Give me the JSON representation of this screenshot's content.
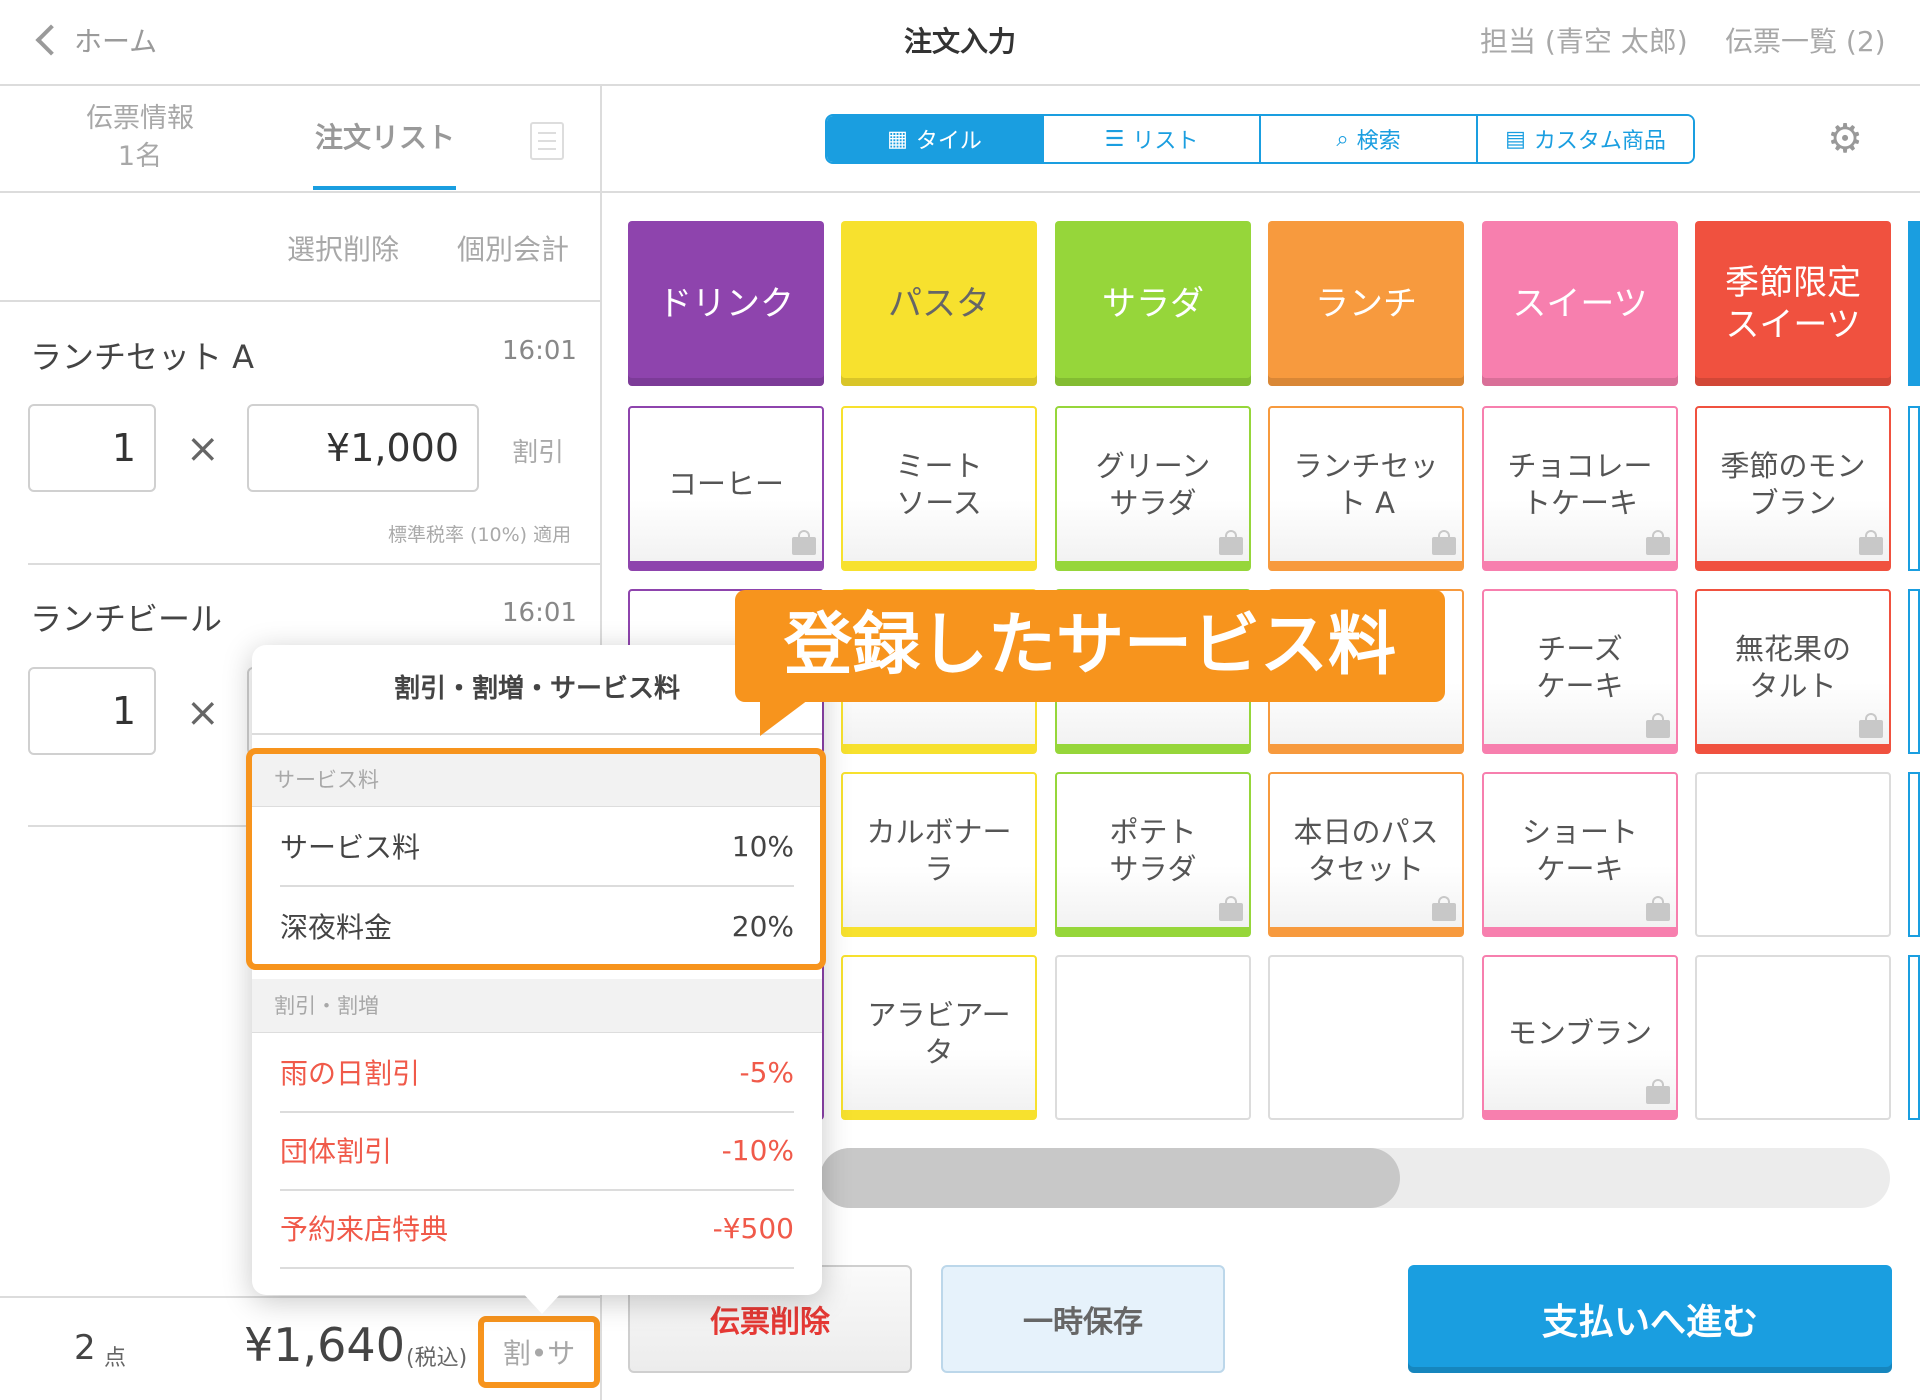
{
  "header": {
    "back_label": "ホーム",
    "title": "注文入力",
    "staff": "担当 (青空 太郎)",
    "slips": "伝票一覧 (2)"
  },
  "left_tabs": {
    "info_label": "伝票情報",
    "info_count": "1名",
    "order_label": "注文リスト"
  },
  "actions": {
    "select_delete": "選択削除",
    "separate_pay": "個別会計"
  },
  "items": [
    {
      "name": "ランチセット A",
      "time": "16:01",
      "qty": "1",
      "price": "¥1,000",
      "discount": "割引",
      "tax_note": "標準税率 (10%) 適用"
    },
    {
      "name": "ランチビール",
      "time": "16:01",
      "qty": "1"
    }
  ],
  "times_symbol": "×",
  "summary": {
    "count": "2",
    "count_unit": "点",
    "total": "¥1,640",
    "tax_note": "(税込)",
    "adjust_button": "割•サ"
  },
  "popover": {
    "title": "割引・割増・サービス料",
    "service_header": "サービス料",
    "service_rows": [
      {
        "label": "サービス料",
        "value": "10%"
      },
      {
        "label": "深夜料金",
        "value": "20%"
      }
    ],
    "discount_header": "割引・割増",
    "discount_rows": [
      {
        "label": "雨の日割引",
        "value": "-5%"
      },
      {
        "label": "団体割引",
        "value": "-10%"
      },
      {
        "label": "予約来店特典",
        "value": "-¥500"
      }
    ]
  },
  "callout": "登録したサービス料",
  "view_tabs": [
    {
      "label": "タイル",
      "icon": "grid-icon",
      "active": true
    },
    {
      "label": "リスト",
      "icon": "list-icon",
      "active": false
    },
    {
      "label": "検索",
      "icon": "search-icon",
      "active": false
    },
    {
      "label": "カスタム商品",
      "icon": "calculator-icon",
      "active": false
    }
  ],
  "categories": [
    {
      "label": "ドリンク",
      "color": "#8e44ad"
    },
    {
      "label": "パスタ",
      "color": "#f7e12e"
    },
    {
      "label": "サラダ",
      "color": "#96d63a"
    },
    {
      "label": "ランチ",
      "color": "#f79a3e"
    },
    {
      "label": "スイーツ",
      "color": "#f77fae"
    },
    {
      "label": "季節限定\nスイーツ",
      "color": "#f0513f"
    }
  ],
  "products": [
    [
      "コーヒー",
      "ミート\nソース",
      "グリーン\nサラダ",
      "ランチセッ\nト A",
      "チョコレー\nトケーキ",
      "季節のモン\nブラン"
    ],
    [
      "",
      "",
      "",
      "",
      "チーズ\nケーキ",
      "無花果の\nタルト"
    ],
    [
      "",
      "カルボナー\nラ",
      "ポテト\nサラダ",
      "本日のパス\nタセット",
      "ショート\nケーキ",
      ""
    ],
    [
      "",
      "アラビアー\nタ",
      "",
      "",
      "モンブラン",
      ""
    ]
  ],
  "buttons": {
    "delete": "伝票削除",
    "hold": "一時保存",
    "pay": "支払いへ進む"
  },
  "colors": {
    "accent": "#1a9ee0",
    "highlight": "#f7941d",
    "discount_text": "#f05a4a"
  }
}
